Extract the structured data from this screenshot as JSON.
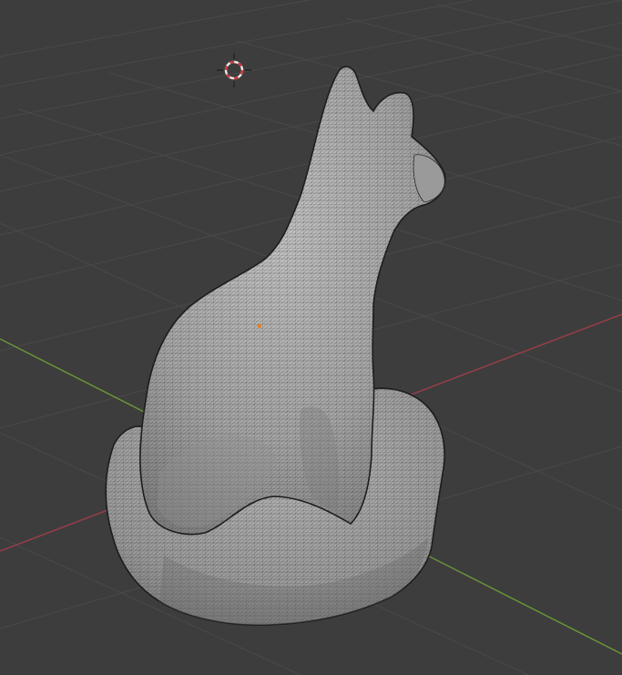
{
  "viewport": {
    "background_color": "#3d3d3d",
    "grid_color": "#4a4a4a",
    "x_axis_color": "#9c3e4a",
    "y_axis_color": "#6d9638"
  },
  "cursor": {
    "icon": "3d-cursor-icon",
    "ring_color_a": "#e8e8e8",
    "ring_color_b": "#d0383b"
  },
  "model": {
    "icon": "cat-statue-mesh",
    "display_mode": "wireframe-overlay",
    "surface_color": "#a8a8a8",
    "wire_color": "#2a2a2a",
    "origin_color": "#e87d22"
  }
}
